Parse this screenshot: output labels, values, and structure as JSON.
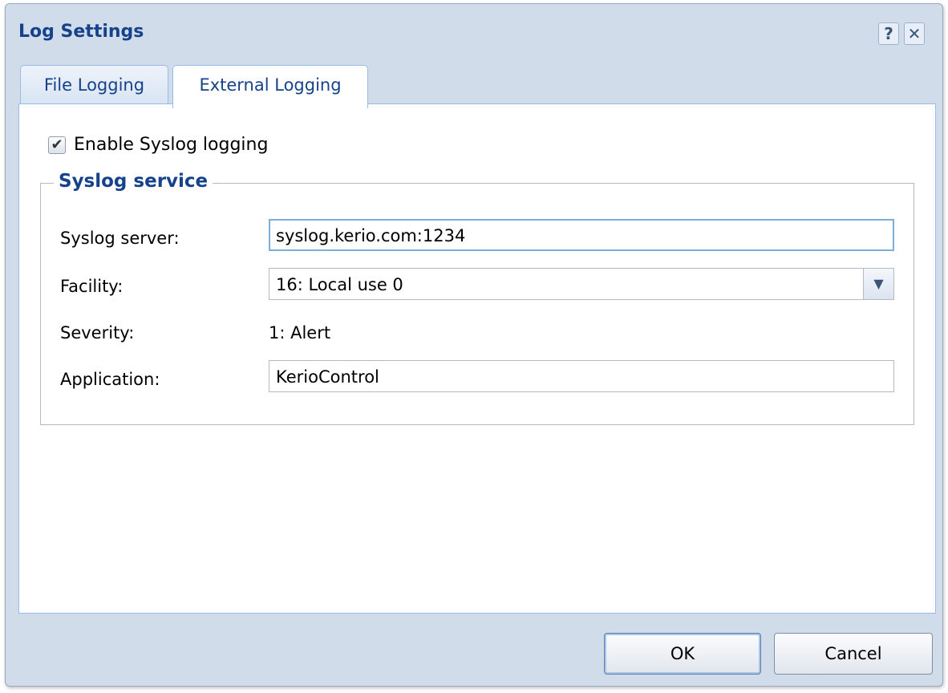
{
  "window": {
    "title": "Log Settings",
    "help_glyph": "?",
    "close_glyph": "✕"
  },
  "tabs": [
    {
      "label": "File Logging",
      "active": false
    },
    {
      "label": "External Logging",
      "active": true
    }
  ],
  "syslog": {
    "enable_label": "Enable Syslog logging",
    "enabled": true,
    "section_title": "Syslog service",
    "server_label": "Syslog server:",
    "server_value": "syslog.kerio.com:1234",
    "facility_label": "Facility:",
    "facility_value": "16: Local use 0",
    "severity_label": "Severity:",
    "severity_value": "1: Alert",
    "application_label": "Application:",
    "application_value": "KerioControl"
  },
  "footer": {
    "ok_label": "OK",
    "cancel_label": "Cancel"
  },
  "icons": {
    "help": "help-icon",
    "close": "close-icon",
    "checkmark": "checkmark-icon",
    "dropdown": "chevron-down-icon"
  },
  "colors": {
    "title": "#15428b",
    "window_bg": "#d1dcea",
    "tab_border": "#99bbe8"
  }
}
